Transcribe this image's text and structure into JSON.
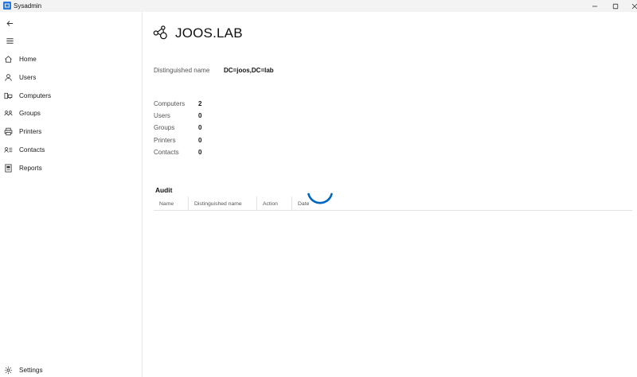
{
  "window": {
    "title": "Sysadmin",
    "controls": [
      "minimize",
      "maximize",
      "close"
    ]
  },
  "sidebar": {
    "back_icon": "back-arrow-icon",
    "menu_icon": "hamburger-icon",
    "items": [
      {
        "label": "Home",
        "icon": "home-icon"
      },
      {
        "label": "Users",
        "icon": "user-icon"
      },
      {
        "label": "Computers",
        "icon": "computer-icon"
      },
      {
        "label": "Groups",
        "icon": "group-icon"
      },
      {
        "label": "Printers",
        "icon": "printer-icon"
      },
      {
        "label": "Contacts",
        "icon": "contacts-icon"
      },
      {
        "label": "Reports",
        "icon": "report-icon"
      }
    ],
    "settings_label": "Settings"
  },
  "main": {
    "title": "JOOS.LAB",
    "dn_label": "Distinguished name",
    "dn_value": "DC=joos,DC=lab",
    "stats": [
      {
        "label": "Computers",
        "value": "2"
      },
      {
        "label": "Users",
        "value": "0"
      },
      {
        "label": "Groups",
        "value": "0"
      },
      {
        "label": "Printers",
        "value": "0"
      },
      {
        "label": "Contacts",
        "value": "0"
      }
    ],
    "audit": {
      "title": "Audit",
      "columns": [
        "Name",
        "Distinguished name",
        "Action",
        "Date"
      ]
    }
  },
  "colors": {
    "accent": "#0067c0",
    "app_icon": "#2b78d8"
  }
}
